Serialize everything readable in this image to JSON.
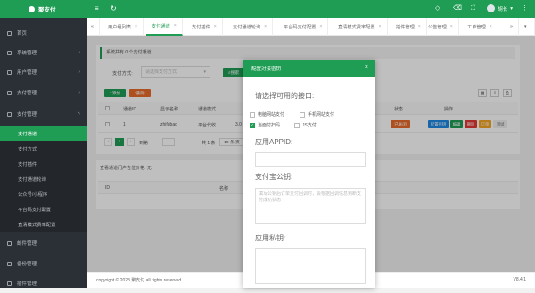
{
  "app": {
    "name": "聚支付"
  },
  "sidebar": {
    "items": [
      {
        "label": "首页"
      },
      {
        "label": "系统管理"
      },
      {
        "label": "用户管理"
      },
      {
        "label": "支付管理"
      },
      {
        "label": "支付管理"
      }
    ],
    "sub": [
      {
        "label": "支付通道"
      },
      {
        "label": "支付方式"
      },
      {
        "label": "支付插件"
      },
      {
        "label": "支付通道轮询"
      },
      {
        "label": "公众号/小程序"
      },
      {
        "label": "平台码支付配置"
      },
      {
        "label": "直清模式费率配置"
      }
    ],
    "more": [
      {
        "label": "邮件管理"
      },
      {
        "label": "备份管理"
      },
      {
        "label": "插件管理"
      }
    ]
  },
  "user": {
    "name": "胡长"
  },
  "tabs": [
    {
      "label": "用户组列表"
    },
    {
      "label": "支付通道"
    },
    {
      "label": "支付插件"
    },
    {
      "label": "支付通道轮询"
    },
    {
      "label": "平台码支付配置"
    },
    {
      "label": "直清模式费率配置"
    },
    {
      "label": "插件管理"
    },
    {
      "label": "公告管理"
    },
    {
      "label": "工单管理"
    }
  ],
  "main": {
    "notice": "系统共有 0 个支付通道",
    "filter_label": "支付方式:",
    "filter_placeholder": "请选择支付方式",
    "search_label": "搜索",
    "add_label": "添加",
    "del_label": "删除",
    "columns": [
      "通道ID",
      "显示名称",
      "通道模式",
      "状态",
      "操作"
    ],
    "row": {
      "id": "1",
      "name": "zhifubao",
      "mode": "平台代收",
      "amount": "3.0"
    },
    "status_badge": "已关闭",
    "actions": [
      "配置密钥",
      "编辑",
      "删除",
      "订单",
      "测试"
    ],
    "page_current": "1",
    "page_goto": "到第",
    "page_total": "共 1 条",
    "page_size": "10 条/页",
    "panel2_title": "查看通道门户告位价格: 无",
    "panel2_cols": [
      "ID",
      "名称"
    ]
  },
  "modal": {
    "title": "配置对接密钥",
    "q_iface": "请选择可用的接口:",
    "opts": [
      {
        "label": "电脑网站支付",
        "checked": false
      },
      {
        "label": "手机网站支付",
        "checked": false
      },
      {
        "label": "当面付扫码",
        "checked": true
      },
      {
        "label": "JS支付",
        "checked": false
      }
    ],
    "appid_label": "应用APPID:",
    "pubkey_label": "支付宝公钥:",
    "pubkey_placeholder": "填写公钥后订单支付回调时，会根据回调信息判断支付成功状态",
    "privkey_label": "应用私钥:"
  },
  "footer": {
    "copyright": "copyright © 2023 聚支付 all rights reserved.",
    "version": "V8.4.1"
  },
  "colors": {
    "brand": "#1f9d55",
    "sidebar": "#2b3036"
  }
}
